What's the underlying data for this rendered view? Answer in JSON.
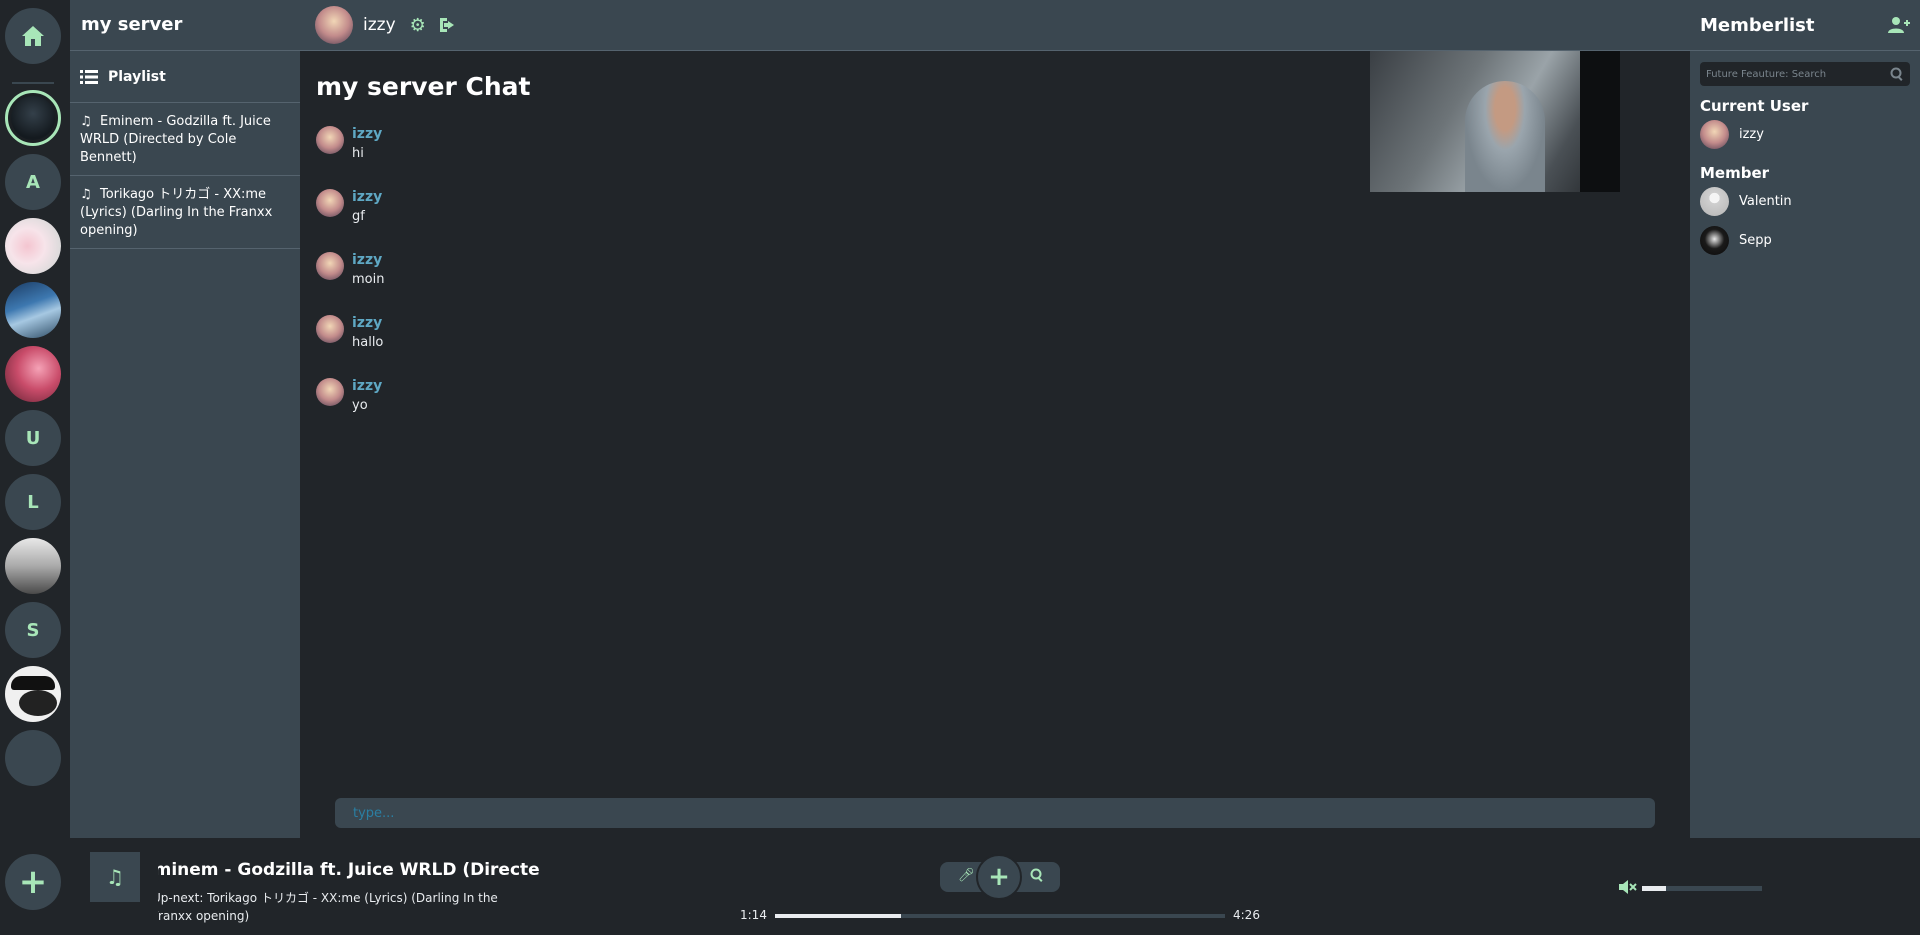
{
  "rail": {
    "servers": [
      {
        "initial": "A"
      },
      {
        "initial": "U"
      },
      {
        "initial": "L"
      },
      {
        "initial": "S"
      }
    ],
    "home_icon": "home-icon",
    "add_icon": "plus-icon"
  },
  "sidebar": {
    "server_name": "my server",
    "playlist_label": "Playlist",
    "playlist": [
      {
        "title": "Eminem - Godzilla ft. Juice WRLD (Directed by Cole Bennett)"
      },
      {
        "title": "Torikago トリカゴ - XX:me (Lyrics) (Darling In the Franxx opening)"
      }
    ]
  },
  "topbar": {
    "username": "izzy",
    "settings_icon": "gear-icon",
    "logout_icon": "logout-icon"
  },
  "chat": {
    "title": "my server Chat",
    "messages": [
      {
        "author": "izzy",
        "text": "hi"
      },
      {
        "author": "izzy",
        "text": "gf"
      },
      {
        "author": "izzy",
        "text": "moin"
      },
      {
        "author": "izzy",
        "text": "hallo"
      },
      {
        "author": "izzy",
        "text": "yo"
      }
    ],
    "input_placeholder": "type..."
  },
  "members": {
    "title": "Memberlist",
    "search_placeholder": "Future Feauture: Search",
    "current_user_label": "Current User",
    "current_user": "izzy",
    "member_label": "Member",
    "list": [
      "Valentin",
      "Sepp"
    ]
  },
  "player": {
    "now_playing": "Eminem - Godzilla ft. Juice WRLD (Directed by Cole Bennett)",
    "next": "Up-next: Torikago トリカゴ - XX:me (Lyrics) (Darling In the Franxx opening)",
    "time_current": "1:14",
    "time_total": "4:26",
    "progress": 0.28,
    "volume": 0.2,
    "accent": "#a8e6b8"
  }
}
